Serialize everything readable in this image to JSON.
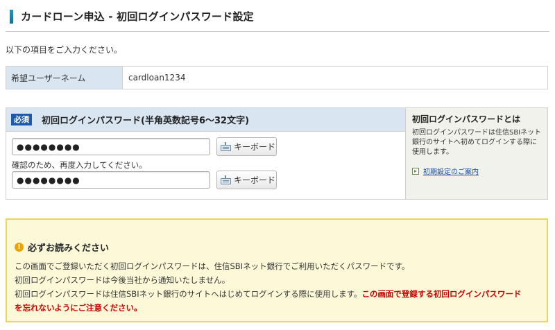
{
  "header": {
    "title": "カードローン申込 - 初回ログインパスワード設定"
  },
  "intro": "以下の項目をご入力ください。",
  "username": {
    "label": "希望ユーザーネーム",
    "value": "cardloan1234"
  },
  "password": {
    "required_badge": "必須",
    "label": "初回ログインパスワード(半角英数記号6～32文字)",
    "value_masked": "●●●●●●●●",
    "confirm_text": "確認のため、再度入力してください。",
    "confirm_value_masked": "●●●●●●●●",
    "keyboard_label": "キーボード"
  },
  "side": {
    "title": "初回ログインパスワードとは",
    "body": "初回ログインパスワードは住信SBIネット銀行のサイトへ初めてログインする際に使用します。",
    "link": "初期設定のご案内"
  },
  "notice": {
    "title": "必ずお読みください",
    "line1": "この画面でご登録いただく初回ログインパスワードは、住信SBIネット銀行でご利用いただくパスワードです。",
    "line2": "初回ログインパスワードは今後当社から通知いたしません。",
    "line3": "初回ログインパスワードは住信SBIネット銀行のサイトへはじめてログインする際に使用します。",
    "warning_part1": "この画面で登録する初回ログインパスワード",
    "warning_part2": "を忘れないようにご注意ください。"
  },
  "colors": {
    "accent": "#1e5aa8",
    "header_cell": "#d9e6f2",
    "notice_bg": "#fdf9d8",
    "notice_border": "#e9d65a",
    "warning": "#cc0000"
  }
}
